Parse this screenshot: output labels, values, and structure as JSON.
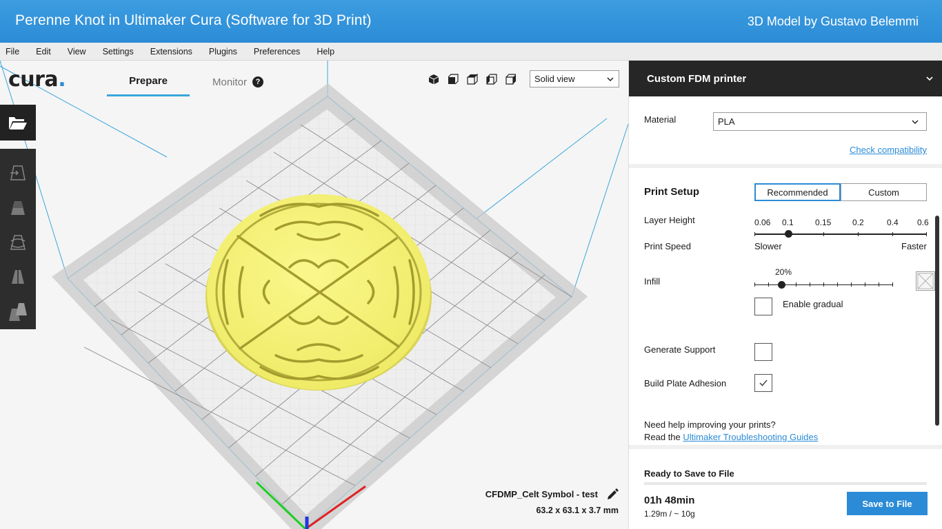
{
  "banner": {
    "title": "Perenne Knot in Ultimaker Cura (Software for 3D Print)",
    "credit": "3D Model by Gustavo Belemmi"
  },
  "menubar": {
    "items": [
      "File",
      "Edit",
      "View",
      "Settings",
      "Extensions",
      "Plugins",
      "Preferences",
      "Help"
    ]
  },
  "toolbar": {
    "logo": "cura",
    "tabs": [
      {
        "label": "Prepare",
        "active": true
      },
      {
        "label": "Monitor",
        "active": false
      }
    ],
    "view_mode": "Solid view",
    "camera_icons": [
      "3d-view-icon",
      "front-view-icon",
      "top-view-icon",
      "left-view-icon",
      "right-view-icon"
    ]
  },
  "left_tools": [
    "open-file-icon",
    "move-tool-icon",
    "scale-tool-icon",
    "rotate-tool-icon",
    "mirror-tool-icon",
    "per-model-settings-icon"
  ],
  "model": {
    "name": "CFDMP_Celt Symbol - test",
    "dimensions": "63.2 x 63.1 x 3.7 mm"
  },
  "panel": {
    "printer": "Custom FDM printer",
    "material_label": "Material",
    "material_value": "PLA",
    "check_compat": "Check compatibility",
    "print_setup": "Print Setup",
    "mode_recommended": "Recommended",
    "mode_custom": "Custom",
    "layer_height_label": "Layer Height",
    "layer_heights": [
      "0.06",
      "0.1",
      "0.15",
      "0.2",
      "0.4",
      "0.6"
    ],
    "layer_height_selected": "0.1",
    "print_speed_label": "Print Speed",
    "speed_slower": "Slower",
    "speed_faster": "Faster",
    "infill_label": "Infill",
    "infill_value": "20%",
    "infill_fraction": 0.2,
    "gradual_label": "Enable gradual",
    "gradual_checked": false,
    "support_label": "Generate Support",
    "support_checked": false,
    "adhesion_label": "Build Plate Adhesion",
    "adhesion_checked": true,
    "help_line1": "Need help improving your prints?",
    "help_line2_prefix": "Read the ",
    "help_link": "Ultimaker Troubleshooting Guides"
  },
  "save": {
    "status": "Ready to Save to File",
    "time": "01h 48min",
    "usage": "1.29m / ~ 10g",
    "button": "Save to File"
  },
  "colors": {
    "accent": "#2b8bd6",
    "model": "#f4f07a",
    "dark": "#262626"
  }
}
